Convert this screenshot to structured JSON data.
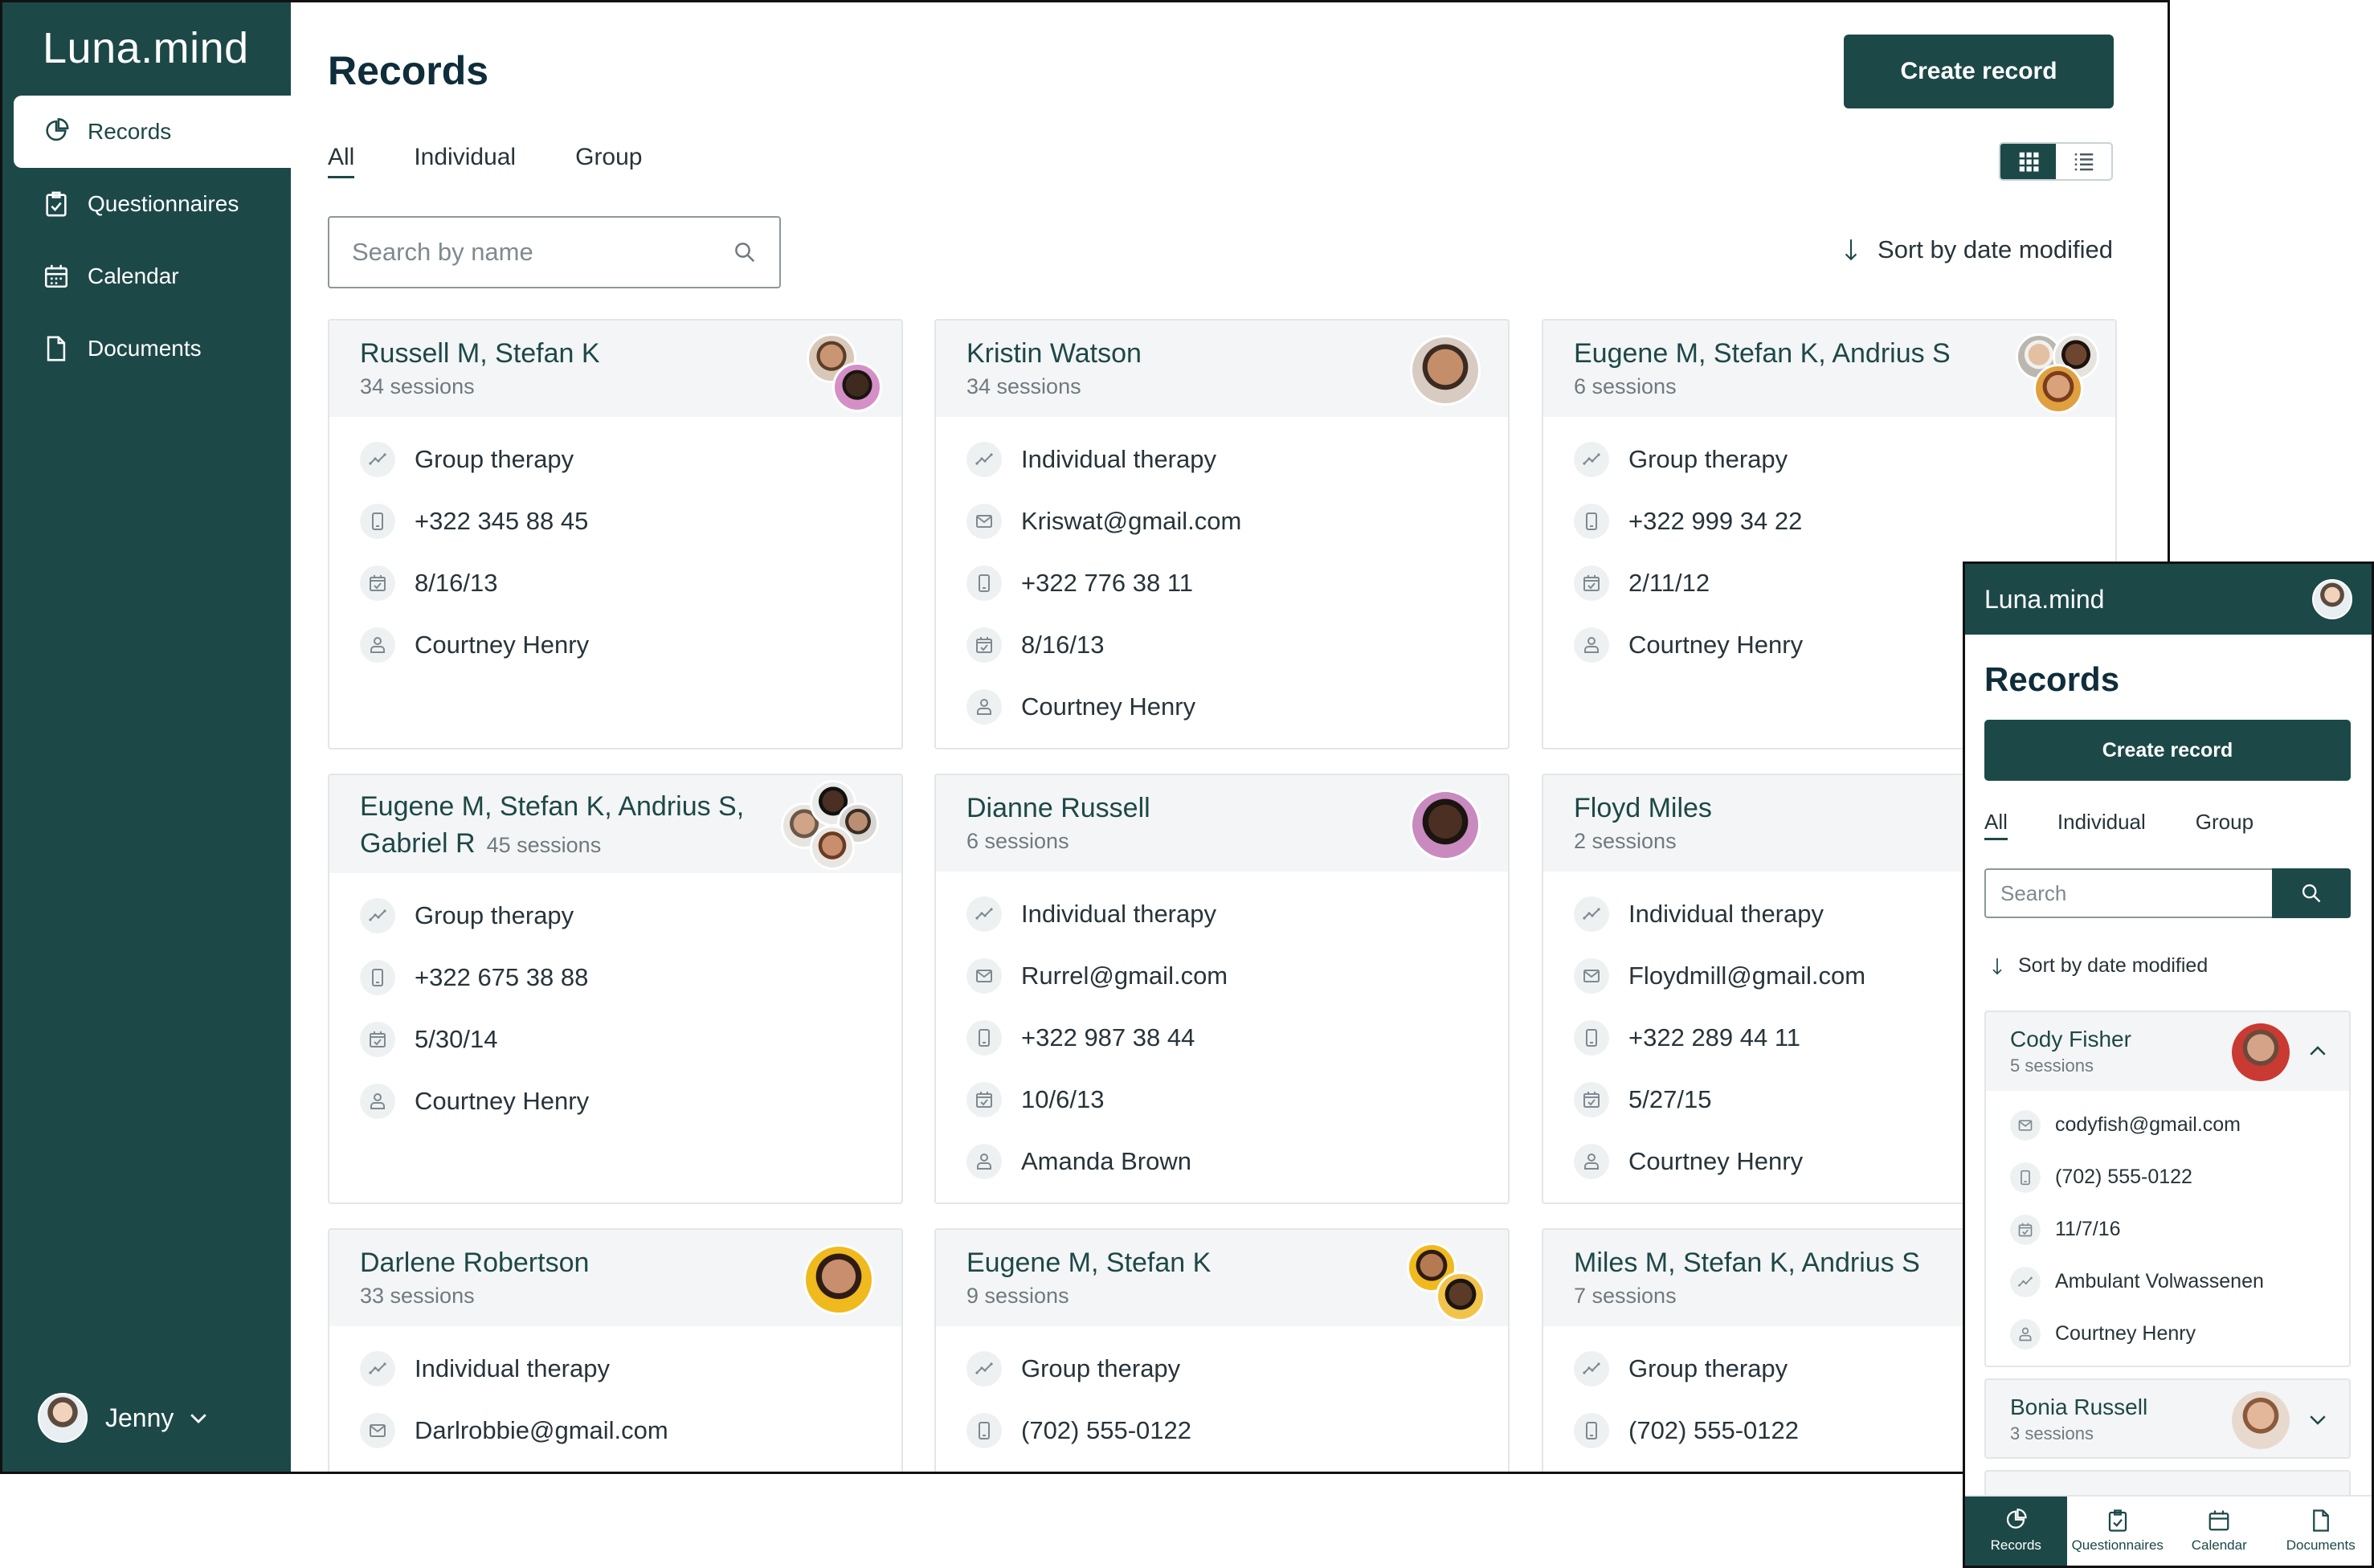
{
  "app": {
    "brand": "Luna.mind"
  },
  "sidebar": {
    "items": [
      {
        "label": "Records",
        "icon": "records-icon",
        "active": true
      },
      {
        "label": "Questionnaires",
        "icon": "clipboard-check-icon",
        "active": false
      },
      {
        "label": "Calendar",
        "icon": "calendar-icon",
        "active": false
      },
      {
        "label": "Documents",
        "icon": "document-icon",
        "active": false
      }
    ],
    "user": {
      "name": "Jenny"
    }
  },
  "main": {
    "title": "Records",
    "create_label": "Create record",
    "tabs": [
      {
        "label": "All",
        "active": true
      },
      {
        "label": "Individual"
      },
      {
        "label": "Group"
      }
    ],
    "view_mode": "grid",
    "search_placeholder": "Search by name",
    "sort_label": "Sort by date modified"
  },
  "records": [
    {
      "name": "Russell M, Stefan K",
      "sessions": "34 sessions",
      "type": "Group therapy",
      "phone": "+322 345 88 45",
      "date": "8/16/13",
      "therapist": "Courtney Henry"
    },
    {
      "name": "Kristin Watson",
      "sessions": "34 sessions",
      "type": "Individual therapy",
      "email": "Kriswat@gmail.com",
      "phone": "+322 776 38 11",
      "date": "8/16/13",
      "therapist": "Courtney Henry"
    },
    {
      "name": "Eugene M, Stefan K, Andrius S",
      "sessions": "6 sessions",
      "type": "Group therapy",
      "phone": "+322 999 34 22",
      "date": "2/11/12",
      "therapist": "Courtney Henry"
    },
    {
      "name": "Eugene M, Stefan K, Andrius S, Gabriel R",
      "sessions": "45 sessions",
      "type": "Group therapy",
      "phone": "+322 675 38 88",
      "date": "5/30/14",
      "therapist": "Courtney Henry"
    },
    {
      "name": "Dianne Russell",
      "sessions": "6 sessions",
      "type": "Individual therapy",
      "email": "Rurrel@gmail.com",
      "phone": "+322 987 38 44",
      "date": "10/6/13",
      "therapist": "Amanda Brown"
    },
    {
      "name": "Floyd Miles",
      "sessions": "2 sessions",
      "type": "Individual therapy",
      "email": "Floydmill@gmail.com",
      "phone": "+322 289 44 11",
      "date": "5/27/15",
      "therapist": "Courtney Henry"
    },
    {
      "name": "Darlene Robertson",
      "sessions": "33 sessions",
      "type": "Individual therapy",
      "email": "Darlrobbie@gmail.com"
    },
    {
      "name": "Eugene M, Stefan K",
      "sessions": "9 sessions",
      "type": "Group therapy",
      "phone": "(702) 555-0122"
    },
    {
      "name": "Miles M, Stefan K, Andrius S",
      "sessions": "7 sessions",
      "type": "Group therapy",
      "phone": "(702) 555-0122"
    }
  ],
  "mobile": {
    "brand": "Luna.mind",
    "title": "Records",
    "create_label": "Create record",
    "tabs": [
      {
        "label": "All",
        "active": true
      },
      {
        "label": "Individual"
      },
      {
        "label": "Group"
      }
    ],
    "search_placeholder": "Search",
    "sort_label": "Sort by date modified",
    "records": [
      {
        "name": "Cody Fisher",
        "sessions": "5 sessions",
        "expanded": true,
        "email": "codyfish@gmail.com",
        "phone": "(702) 555-0122",
        "date": "11/7/16",
        "type": "Ambulant Volwassenen",
        "therapist": "Courtney Henry"
      },
      {
        "name": "Bonia Russell",
        "sessions": "3 sessions",
        "expanded": false
      }
    ],
    "bottom_nav": [
      {
        "label": "Records",
        "active": true
      },
      {
        "label": "Questionnaires"
      },
      {
        "label": "Calendar"
      },
      {
        "label": "Documents"
      }
    ]
  },
  "colors": {
    "brand": "#1d4848",
    "card_header": "#f4f5f6",
    "muted": "#6f7a80"
  }
}
